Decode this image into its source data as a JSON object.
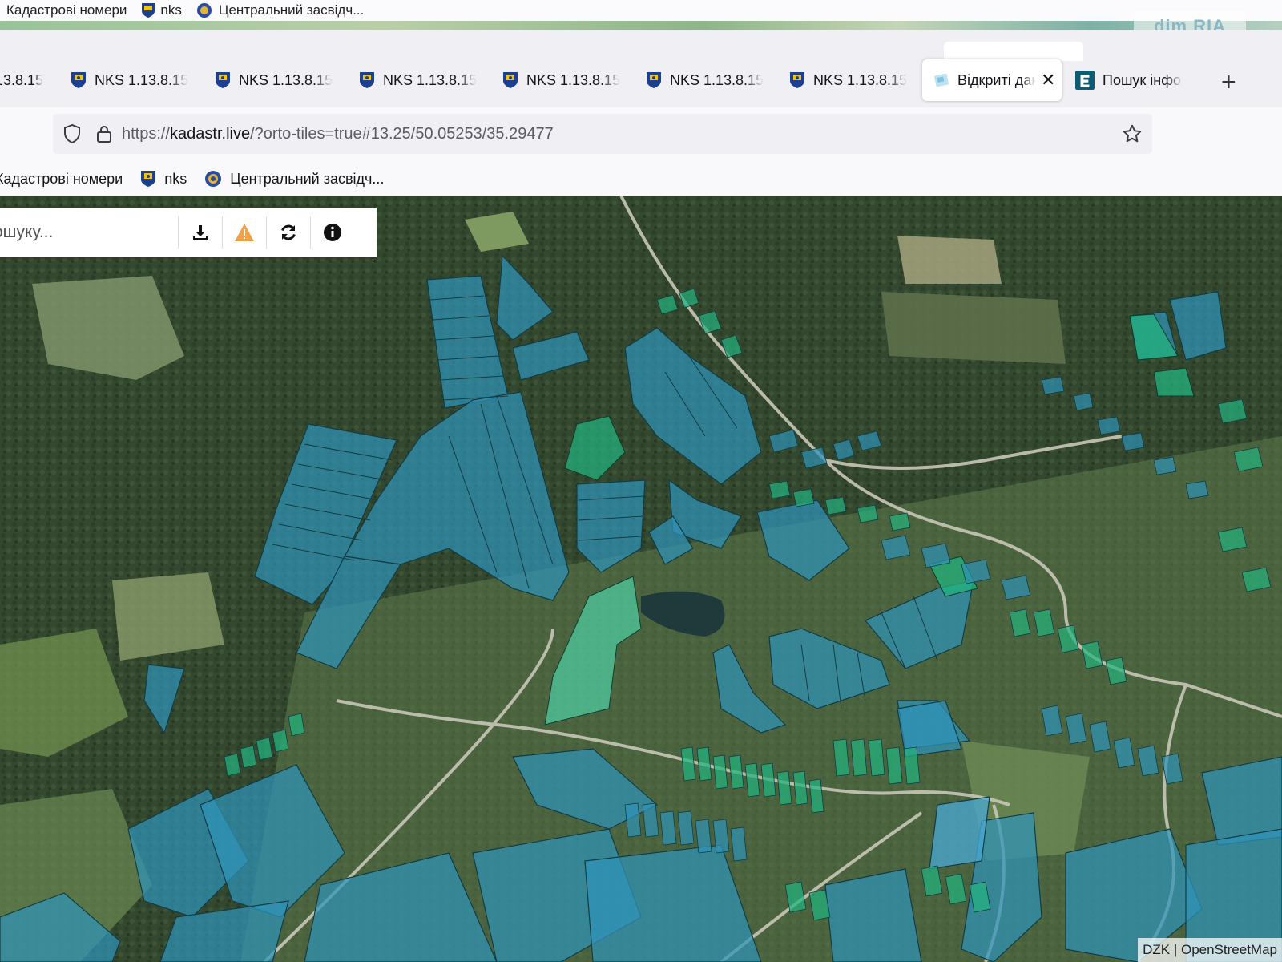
{
  "prev_window": {
    "bookmarks": [
      "Кадастрові номери",
      "nks",
      "Центральний засвідч..."
    ],
    "watermark": "dim RIA"
  },
  "tabs": [
    {
      "label": "NKS 1.13.8.15",
      "active": false
    },
    {
      "label": "NKS 1.13.8.15",
      "active": false
    },
    {
      "label": "NKS 1.13.8.15",
      "active": false
    },
    {
      "label": "NKS 1.13.8.15",
      "active": false
    },
    {
      "label": "NKS 1.13.8.15",
      "active": false
    },
    {
      "label": "NKS 1.13.8.15",
      "active": false
    },
    {
      "label": "NKS 1.13.8.15",
      "active": false
    },
    {
      "label": "Відкриті дані",
      "active": true
    },
    {
      "label": "Пошук інформації",
      "active": false
    }
  ],
  "tab_close_symbol": "✕",
  "new_tab_symbol": "+",
  "url": {
    "scheme": "https://",
    "host": "kadastr.live",
    "path": "/?orto-tiles=true#13.25/50.05253/35.29477"
  },
  "bookmarks": [
    {
      "label": "Кадастрові номери",
      "icon": "folder-icon"
    },
    {
      "label": "nks",
      "icon": "nks-favicon-icon"
    },
    {
      "label": "Центральний засвідч...",
      "icon": "globe-seal-icon"
    }
  ],
  "map": {
    "search_placeholder": "ошуку...",
    "tools": [
      "download-icon",
      "warning-icon",
      "refresh-icon",
      "info-icon"
    ],
    "attribution": "DZK | OpenStreetMap",
    "colors": {
      "parcel_blue": "#2f93b8",
      "parcel_green": "#23b37e",
      "parcel_highlight": "#4fe3b6",
      "forest": "#34482f",
      "field": "#6f8d55"
    }
  }
}
